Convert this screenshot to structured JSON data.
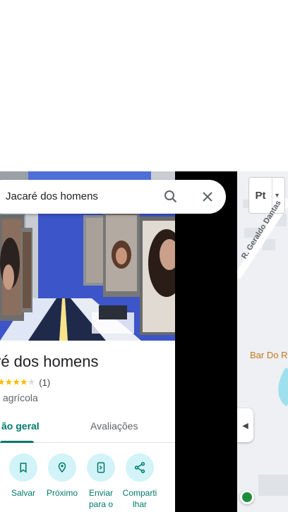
{
  "search": {
    "query": "Jacaré dos homens"
  },
  "place": {
    "title": "ré dos homens",
    "rating_stars": 4,
    "rating_count": "(1)",
    "category": "agrícola"
  },
  "tabs": [
    {
      "label": "ão geral",
      "active": true
    },
    {
      "label": "Avaliações",
      "active": false
    }
  ],
  "actions": [
    {
      "label": "Salvar",
      "icon": "bookmark-icon"
    },
    {
      "label": "Próximo",
      "icon": "nearby-icon"
    },
    {
      "label": "Enviar para o",
      "icon": "send-to-phone-icon"
    },
    {
      "label": "Comparti lhar",
      "icon": "share-icon"
    }
  ],
  "map": {
    "layer_label": "Pt",
    "road_label": "R. Geraldo Dantas",
    "poi_label": "Bar Do R"
  },
  "colors": {
    "accent": "#00796b",
    "action_bg": "#d2f3f7",
    "star": "#fbbc04",
    "poi": "#c5761f"
  }
}
